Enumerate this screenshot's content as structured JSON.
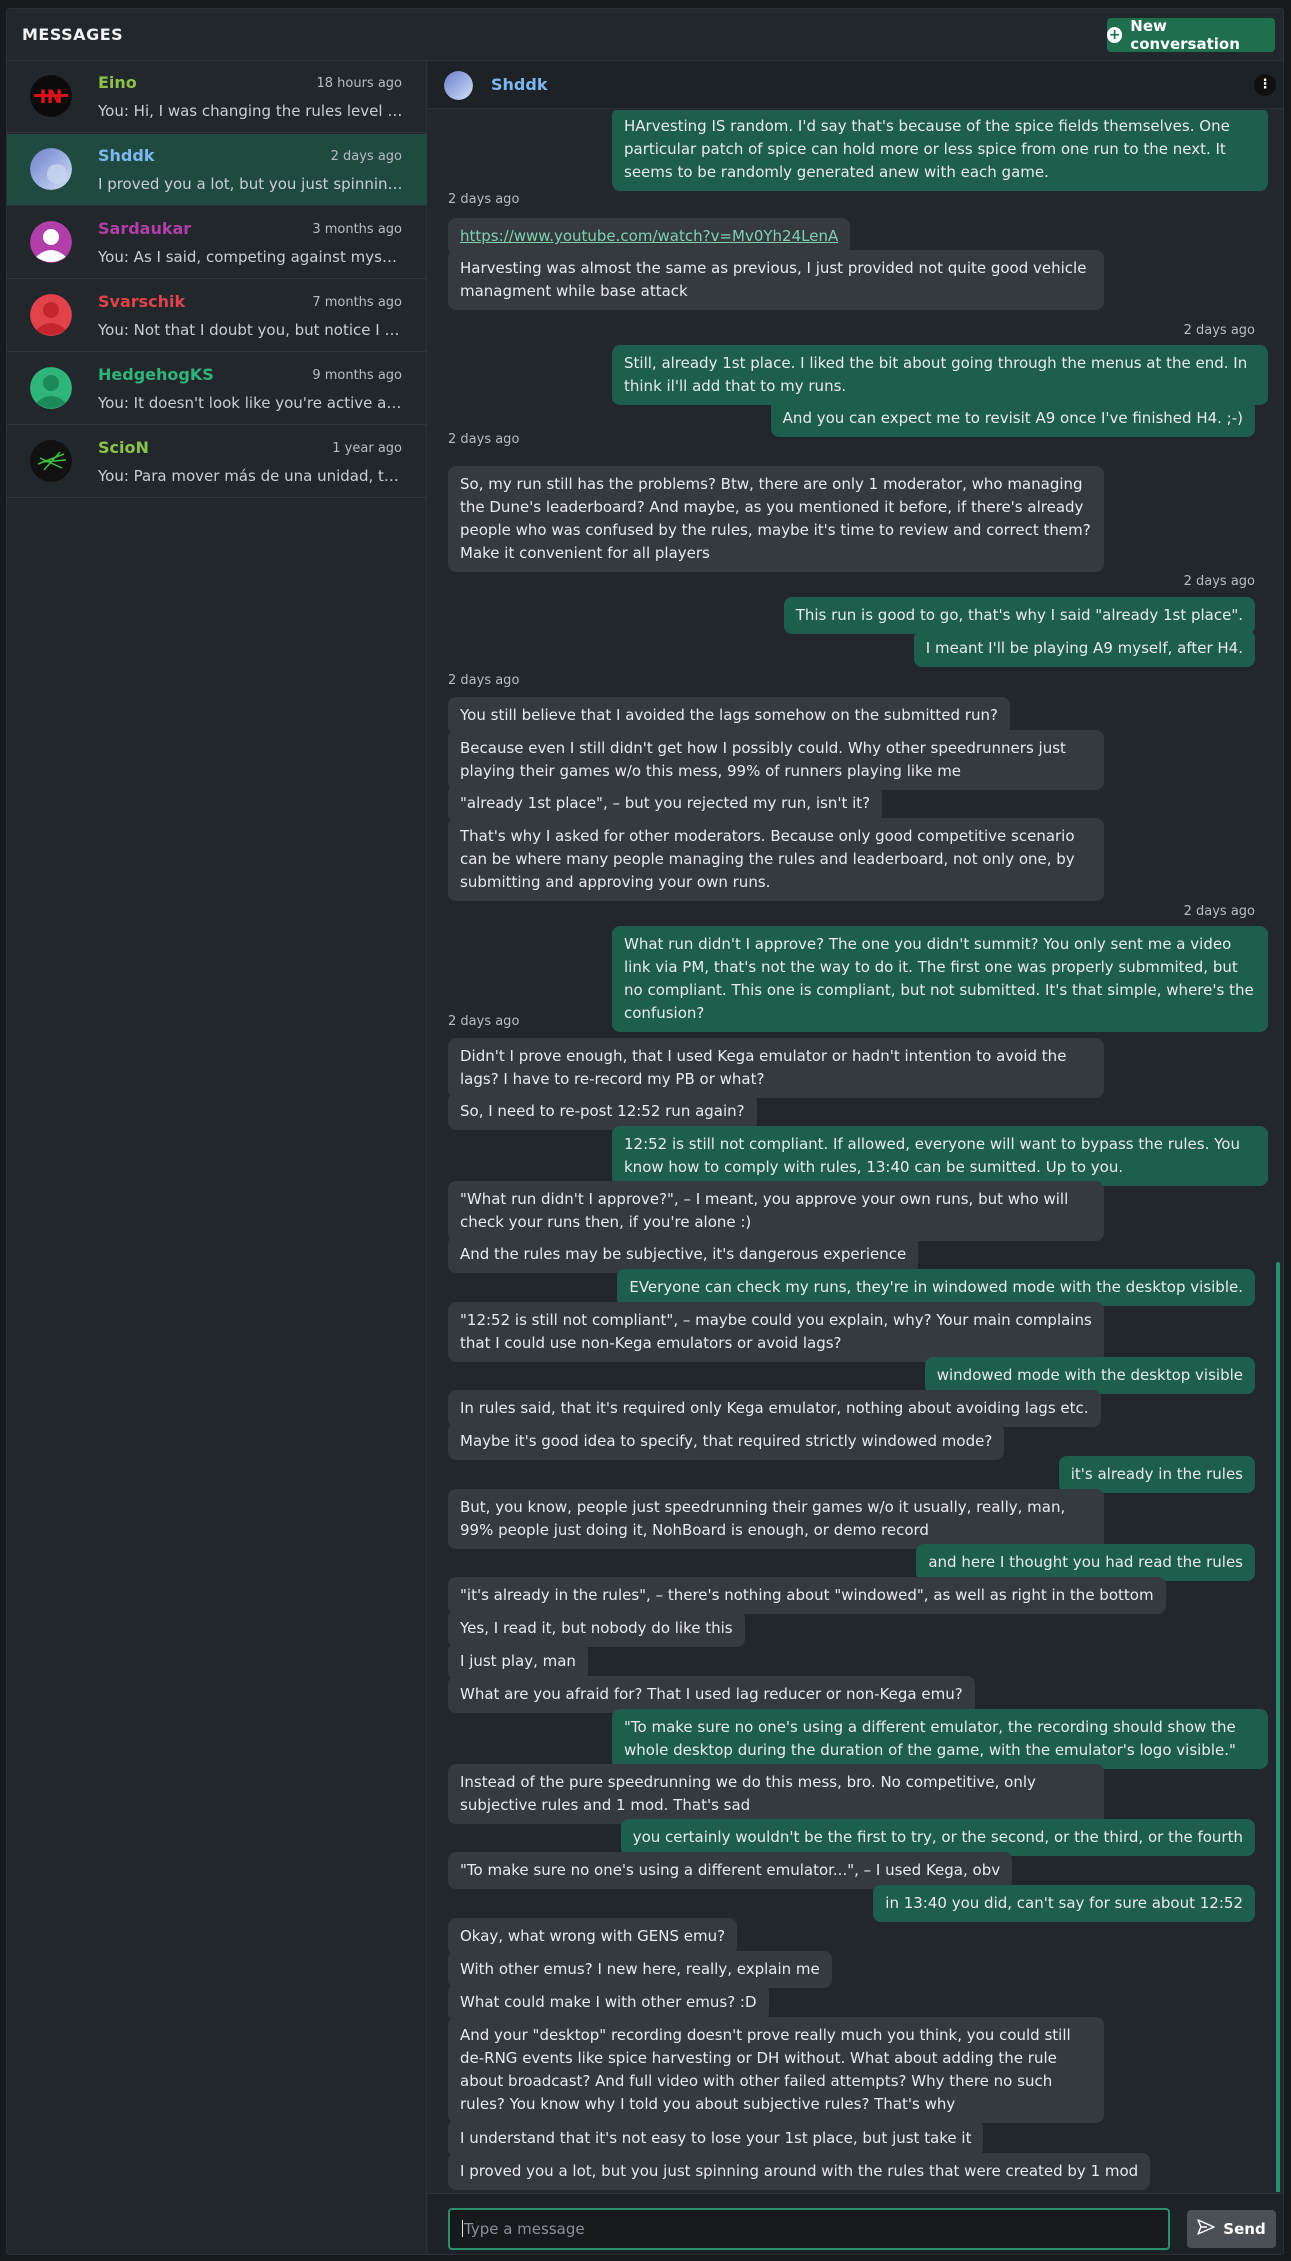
{
  "app": {
    "title": "MESSAGES",
    "new_conversation": "New conversation"
  },
  "conversations": [
    {
      "name": "Eino",
      "time": "18 hours ago",
      "preview": "You: Hi, I was changing the rules level for leaderboards...",
      "color": "#8bc34a"
    },
    {
      "name": "Shddk",
      "time": "2 days ago",
      "preview": "I proved you a lot, but you just spinning around with the rules",
      "color": "#7cb7ef"
    },
    {
      "name": "Sardaukar",
      "time": "3 months ago",
      "preview": "You: As I said, competing against myself has no sense",
      "color": "#b23ea9"
    },
    {
      "name": "Svarschik",
      "time": "7 months ago",
      "preview": "You: Not that I doubt you, but notice I replaced the run",
      "color": "#e2434a"
    },
    {
      "name": "HedgehogKS",
      "time": "9 months ago",
      "preview": "You: It doesn't look like you're active anymore here",
      "color": "#2fb57a"
    },
    {
      "name": "ScioN",
      "time": "1 year ago",
      "preview": "You: Para mover más de una unidad, tienes que",
      "color": "#8bc34a"
    }
  ],
  "chat": {
    "contact": "Shddk",
    "input_placeholder": "Type a message",
    "send_label": "Send",
    "timestamps": [
      "2 days ago",
      "2 days ago",
      "2 days ago",
      "2 days ago",
      "2 days ago",
      "2 days ago",
      "2 days ago"
    ],
    "messages": [
      {
        "dir": "out",
        "text": "HArvesting IS random. I'd say that's because of the spice fields themselves. One particular patch of spice can hold more or less spice from one run to the next. It seems to be randomly generated anew with each game."
      },
      {
        "dir": "in",
        "text": "https://www.youtube.com/watch?v=Mv0Yh24LenA"
      },
      {
        "dir": "in",
        "text": "Harvesting was almost the same as previous, I just provided not quite good vehicle managment while base attack"
      },
      {
        "dir": "out",
        "text": "Still, already 1st place. I liked the bit about going through the menus at the end. In think il'll add that to my runs."
      },
      {
        "dir": "out",
        "text": "And you can expect me to revisit A9 once I've finished H4. ;-)"
      },
      {
        "dir": "in",
        "text": "So, my run still has the problems? Btw, there are only 1 moderator, who managing the Dune's leaderboard? And maybe, as you mentioned it before, if there's already people who was confused by the rules, maybe it's time to review and correct them? Make it convenient for all players"
      },
      {
        "dir": "out",
        "text": "This run is good to go, that's why I said \"already 1st place\"."
      },
      {
        "dir": "out",
        "text": "I meant I'll be playing A9 myself, after H4."
      },
      {
        "dir": "in",
        "text": "You still believe that I avoided the lags somehow on the submitted run?"
      },
      {
        "dir": "in",
        "text": "Because even I still didn't get how I possibly could. Why other speedrunners just playing their games w/o this mess, 99% of runners playing like me"
      },
      {
        "dir": "in",
        "text": "\"already 1st place\", – but you rejected my run, isn't it?"
      },
      {
        "dir": "in",
        "text": "That's why I asked for other moderators. Because only good competitive scenario can be where many people managing the rules and leaderboard, not only one, by submitting and approving your own runs."
      },
      {
        "dir": "out",
        "text": "What run didn't I approve? The one you didn't summit? You only sent me a video link via PM, that's not the way to do it. The first one was properly submmited, but no compliant. This one is compliant, but not submitted. It's that simple, where's the confusion?"
      },
      {
        "dir": "in",
        "text": "Didn't I prove enough, that I used Kega emulator or hadn't intention to avoid the lags? I have to re-record my PB or what?"
      },
      {
        "dir": "in",
        "text": "So, I need to re-post 12:52 run again?"
      },
      {
        "dir": "out",
        "text": "12:52 is still not compliant. If allowed, everyone will want to bypass the rules. You know how to comply with rules, 13:40 can be sumitted. Up to you."
      },
      {
        "dir": "in",
        "text": "\"What run didn't I approve?\", – I meant, you approve your own runs, but who will check your runs then, if you're alone :)"
      },
      {
        "dir": "in",
        "text": "And the rules may be subjective, it's dangerous experience"
      },
      {
        "dir": "out",
        "text": "EVeryone can check my runs, they're in windowed mode with the desktop visible."
      },
      {
        "dir": "in",
        "text": "\"12:52 is still not compliant\", – maybe could you explain, why? Your main complains that I could use non-Kega emulators or avoid lags?"
      },
      {
        "dir": "out",
        "text": "windowed mode with the desktop visible"
      },
      {
        "dir": "in",
        "text": "In rules said, that it's required only Kega emulator, nothing about avoiding lags etc."
      },
      {
        "dir": "in",
        "text": "Maybe it's good idea to specify, that required strictly windowed mode?"
      },
      {
        "dir": "out",
        "text": "it's already in the rules"
      },
      {
        "dir": "in",
        "text": "But, you know, people just speedrunning their games w/o it usually, really, man, 99% people just doing it, NohBoard is enough, or demo record"
      },
      {
        "dir": "out",
        "text": "and here I thought you had read the rules"
      },
      {
        "dir": "in",
        "text": "\"it's already in the rules\", – there's nothing about \"windowed\", as well as right in the bottom"
      },
      {
        "dir": "in",
        "text": "Yes, I read it, but nobody do like this"
      },
      {
        "dir": "in",
        "text": "I just play, man"
      },
      {
        "dir": "in",
        "text": "What are you afraid for? That I used lag reducer or non-Kega emu?"
      },
      {
        "dir": "out",
        "text": "\"To make sure no one's using a different emulator, the recording should show the whole desktop during the duration of the game, with the emulator's logo visible.\""
      },
      {
        "dir": "in",
        "text": "Instead of the pure speedrunning we do this mess, bro. No competitive, only subjective rules and 1 mod. That's sad"
      },
      {
        "dir": "out",
        "text": "you certainly wouldn't be the first to try, or the second, or the third, or the fourth"
      },
      {
        "dir": "in",
        "text": "\"To make sure no one's using a different emulator...\", – I used Kega, obv"
      },
      {
        "dir": "out",
        "text": "in 13:40 you did, can't say for sure about 12:52"
      },
      {
        "dir": "in",
        "text": "Okay, what wrong with GENS emu?"
      },
      {
        "dir": "in",
        "text": "With other emus? I new here, really, explain me"
      },
      {
        "dir": "in",
        "text": "What could make I with other emus? :D"
      },
      {
        "dir": "in",
        "text": "And your \"desktop\" recording doesn't prove really much you think, you could still de-RNG events like spice harvesting or DH without. What about adding the rule about broadcast? And full video with other failed attempts? Why there no such rules? You know why I told you about subjective rules? That's why"
      },
      {
        "dir": "in",
        "text": "I understand that it's not easy to lose your 1st place, but just take it"
      },
      {
        "dir": "in",
        "text": "I proved you a lot, but you just spinning around with the rules that were created by 1 mod"
      }
    ]
  }
}
